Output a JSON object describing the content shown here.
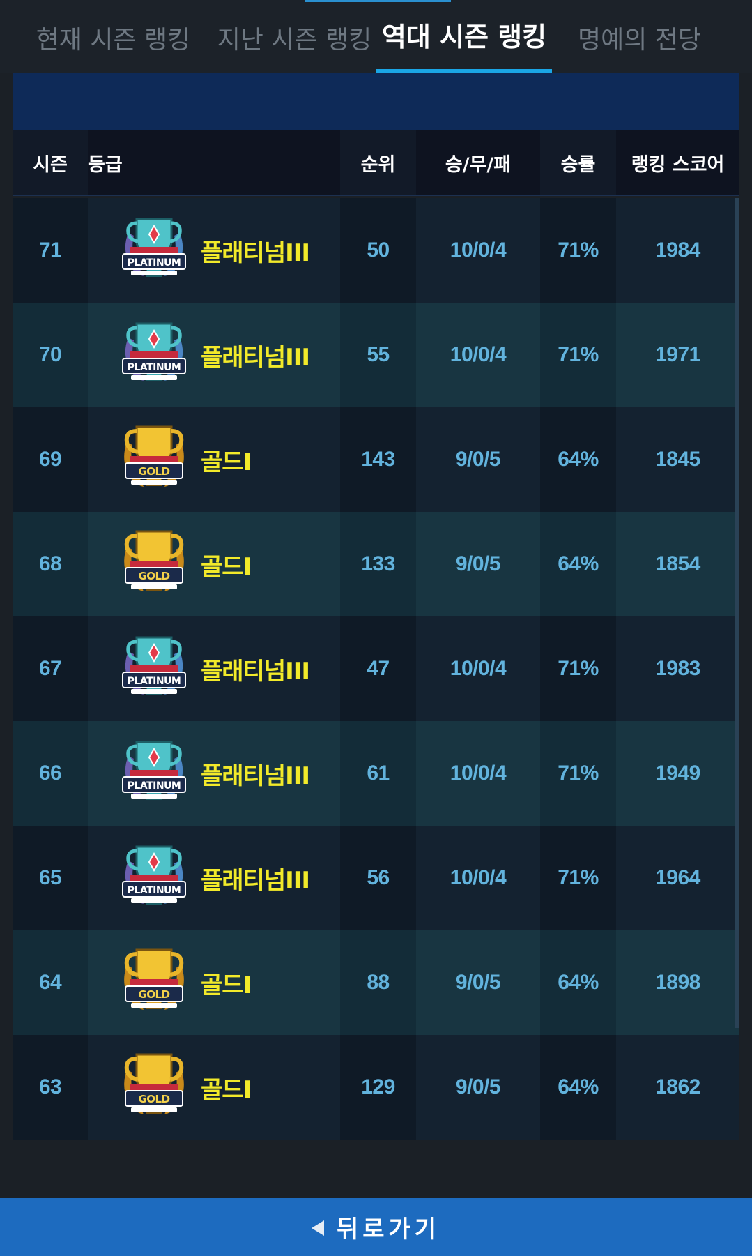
{
  "tabs": [
    {
      "label": "현재 시즌 랭킹",
      "active": false
    },
    {
      "label": "지난 시즌 랭킹",
      "active": false
    },
    {
      "label": "역대 시즌 랭킹",
      "active": true
    },
    {
      "label": "명예의 전당",
      "active": false
    }
  ],
  "table": {
    "headers": {
      "season": "시즌",
      "grade": "등급",
      "rank": "순위",
      "wdl": "승/무/패",
      "winrate": "승률",
      "score": "랭킹 스코어"
    },
    "rows": [
      {
        "season": "71",
        "badge": "PLATINUM",
        "badge_icon": "platinum-trophy-icon",
        "grade": "플래티넘III",
        "rank": "50",
        "wdl": "10/0/4",
        "winrate": "71%",
        "score": "1984"
      },
      {
        "season": "70",
        "badge": "PLATINUM",
        "badge_icon": "platinum-trophy-icon",
        "grade": "플래티넘III",
        "rank": "55",
        "wdl": "10/0/4",
        "winrate": "71%",
        "score": "1971"
      },
      {
        "season": "69",
        "badge": "GOLD",
        "badge_icon": "gold-trophy-icon",
        "grade": "골드I",
        "rank": "143",
        "wdl": "9/0/5",
        "winrate": "64%",
        "score": "1845"
      },
      {
        "season": "68",
        "badge": "GOLD",
        "badge_icon": "gold-trophy-icon",
        "grade": "골드I",
        "rank": "133",
        "wdl": "9/0/5",
        "winrate": "64%",
        "score": "1854"
      },
      {
        "season": "67",
        "badge": "PLATINUM",
        "badge_icon": "platinum-trophy-icon",
        "grade": "플래티넘III",
        "rank": "47",
        "wdl": "10/0/4",
        "winrate": "71%",
        "score": "1983"
      },
      {
        "season": "66",
        "badge": "PLATINUM",
        "badge_icon": "platinum-trophy-icon",
        "grade": "플래티넘III",
        "rank": "61",
        "wdl": "10/0/4",
        "winrate": "71%",
        "score": "1949"
      },
      {
        "season": "65",
        "badge": "PLATINUM",
        "badge_icon": "platinum-trophy-icon",
        "grade": "플래티넘III",
        "rank": "56",
        "wdl": "10/0/4",
        "winrate": "71%",
        "score": "1964"
      },
      {
        "season": "64",
        "badge": "GOLD",
        "badge_icon": "gold-trophy-icon",
        "grade": "골드I",
        "rank": "88",
        "wdl": "9/0/5",
        "winrate": "64%",
        "score": "1898"
      },
      {
        "season": "63",
        "badge": "GOLD",
        "badge_icon": "gold-trophy-icon",
        "grade": "골드I",
        "rank": "129",
        "wdl": "9/0/5",
        "winrate": "64%",
        "score": "1862"
      }
    ]
  },
  "footer": {
    "back_label": "뒤로가기",
    "back_icon": "back-arrow-icon"
  },
  "colors": {
    "accent": "#1aa6e6",
    "grade_text": "#f2ea2a",
    "cell_text": "#62b3dd",
    "back_bar": "#1d6bbf",
    "platinum": "#4fc3c9",
    "gold": "#e0a51c"
  }
}
